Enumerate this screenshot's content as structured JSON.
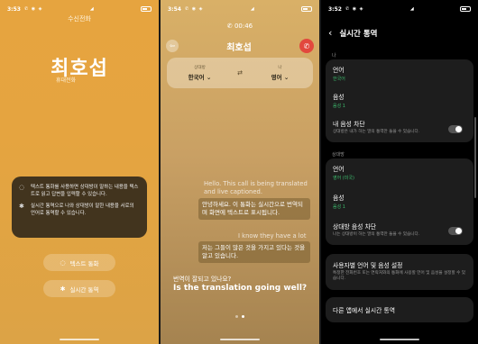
{
  "panel1": {
    "status": {
      "time": "3:53"
    },
    "label": "수신전화",
    "caller_name": "최호섭",
    "caller_type": "휴대전화",
    "info": [
      {
        "icon": "chat-bubble-icon",
        "text": "텍스트 통화를 사용하면 상대방이 말하는 내용을 텍스트로 읽고 답변을 입력할 수 있습니다."
      },
      {
        "icon": "translate-icon",
        "text": "실시간 통역으로 나와 상대방이 말한 내용을 서로의 언어로 통역할 수 있습니다."
      }
    ],
    "btn_text_call": "텍스트 통화",
    "btn_live_translate": "실시간 통역"
  },
  "panel2": {
    "status": {
      "time": "3:54"
    },
    "timer": "00:46",
    "caller_name": "최호섭",
    "lang_left_who": "상대방",
    "lang_left": "한국어",
    "lang_right_who": "나",
    "lang_right": "영어",
    "messages": {
      "en1": "Hello. This call is being translated and live captioned.",
      "ko1": "안녕하세요. 이 통화는 실시간으로 번역되며 화면에 텍스트로 표시됩니다.",
      "en2": "I know they have a lot",
      "ko2": "저는 그들이 많은 것을 가지고 있다는 것을 알고 있습니다.",
      "ko_q": "번역이 잘되고 있나요?",
      "en_q": "Is the translation going well?"
    }
  },
  "panel3": {
    "status": {
      "time": "3:52"
    },
    "title": "실시간 통역",
    "section_me": "나",
    "me_language_label": "언어",
    "me_language_value": "한국어",
    "me_voice_label": "음성",
    "me_voice_value": "음성 1",
    "me_mute_label": "내 음성 차단",
    "me_mute_desc": "상대방은 내가 하는 말의 통역만 들을 수 있습니다.",
    "section_other": "상대방",
    "other_language_label": "언어",
    "other_language_value": "영어 (미국)",
    "other_voice_label": "음성",
    "other_voice_value": "음성 1",
    "other_mute_label": "상대방 음성 차단",
    "other_mute_desc": "나는 상대방이 하는 말의 통역만 들을 수 있습니다.",
    "per_app_title": "사용자별 언어 및 음성 설정",
    "per_app_desc": "특정한 전화번호 또는 연락처와의 통화에 사용할 언어 및 음성을 설정할 수 있습니다.",
    "other_apps": "다른 앱에서 실시간 통역"
  }
}
